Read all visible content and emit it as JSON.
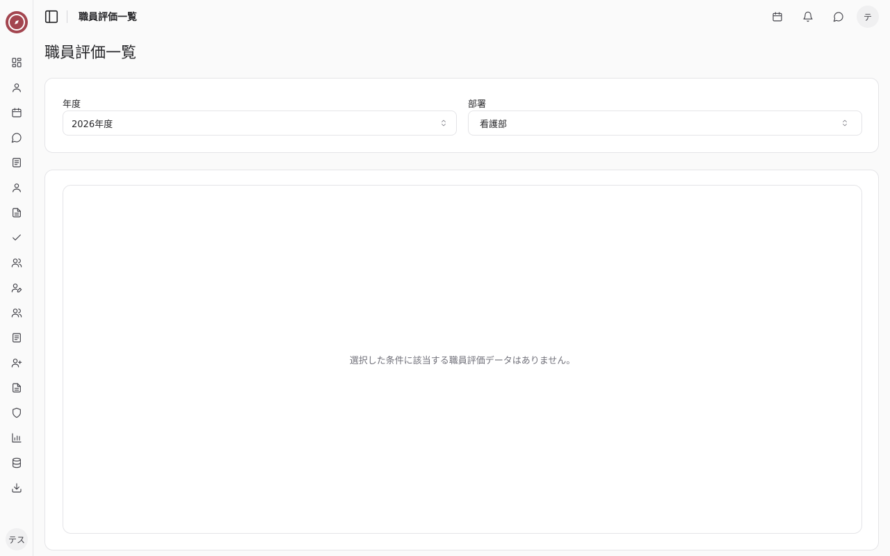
{
  "header": {
    "title": "職員評価一覧",
    "avatar_initial": "テ"
  },
  "sidebar": {
    "user_initials": "テス",
    "items": [
      {
        "icon": "dashboard-icon"
      },
      {
        "icon": "user-icon"
      },
      {
        "icon": "calendar-icon"
      },
      {
        "icon": "message-icon"
      },
      {
        "icon": "notebook-icon"
      },
      {
        "icon": "user-icon"
      },
      {
        "icon": "file-text-icon"
      },
      {
        "icon": "check-icon"
      },
      {
        "icon": "users-icon"
      },
      {
        "icon": "user-pen-icon"
      },
      {
        "icon": "users-icon"
      },
      {
        "icon": "notebook-icon"
      },
      {
        "icon": "user-plus-icon"
      },
      {
        "icon": "file-text-icon"
      },
      {
        "icon": "shield-icon"
      },
      {
        "icon": "bar-chart-icon"
      },
      {
        "icon": "database-icon"
      },
      {
        "icon": "download-icon"
      }
    ]
  },
  "main": {
    "page_title": "職員評価一覧",
    "filters": {
      "year_label": "年度",
      "year_value": "2026年度",
      "dept_label": "部署",
      "dept_value": "看護部"
    },
    "empty_message": "選択した条件に該当する職員評価データはありません。"
  },
  "colors": {
    "brand": "#a3454f",
    "border": "#e4e4e7",
    "muted_text": "#71717a"
  }
}
